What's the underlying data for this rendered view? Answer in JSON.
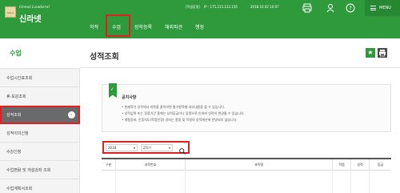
{
  "header": {
    "logo_tagline": "Great Leaders!",
    "logo_name": "신라넷",
    "user_label": "[학생증명]",
    "ip_text": "IP : 175.215.122.156",
    "datetime": "2018.10.02 10:07",
    "menu_label": "MENU",
    "icons": [
      "print-icon",
      "person-icon",
      "help-icon",
      "power-icon",
      "menu-icon"
    ]
  },
  "nav": {
    "items": [
      {
        "label": "학적"
      },
      {
        "label": "수업",
        "active": true
      },
      {
        "label": "장학등록"
      },
      {
        "label": "해외파견"
      },
      {
        "label": "행정"
      }
    ]
  },
  "sidebar": {
    "title": "수업",
    "items": [
      {
        "label": "수업시간표조회"
      },
      {
        "label": "휴·보강조회"
      },
      {
        "label": "성적조회",
        "active": true
      },
      {
        "label": "성적이의신청"
      },
      {
        "label": "수강신청"
      },
      {
        "label": "수업편람 및 개설강좌 조회"
      },
      {
        "label": "수업계획서조회"
      }
    ]
  },
  "main": {
    "title": "성적조회",
    "notice": {
      "title": "공지사항",
      "lines": [
        "• 현재학기 성적에서 과목을 클릭하면 평가항목별 세부내용을 볼 수 있습니다.",
        "• 성적입력 또는 정정기간 중에는 성적등급이나 증명으로 인하여 성적이 변경될 수 있습니다.",
        "• 계절강좌, 인증지도(학점인정) 강좌는 종합 및 학생의 성적계산에 반영되지 않습니다."
      ]
    },
    "filter": {
      "year": "2018",
      "term": "2학기"
    },
    "table": {
      "columns": [
        "구분",
        "과목번호",
        "과목명",
        "학점",
        "성적",
        "등급"
      ]
    }
  },
  "colors": {
    "brand_green": "#2e9a3c",
    "highlight_red": "#e02020",
    "sidebar_active": "#6a6a6a"
  }
}
